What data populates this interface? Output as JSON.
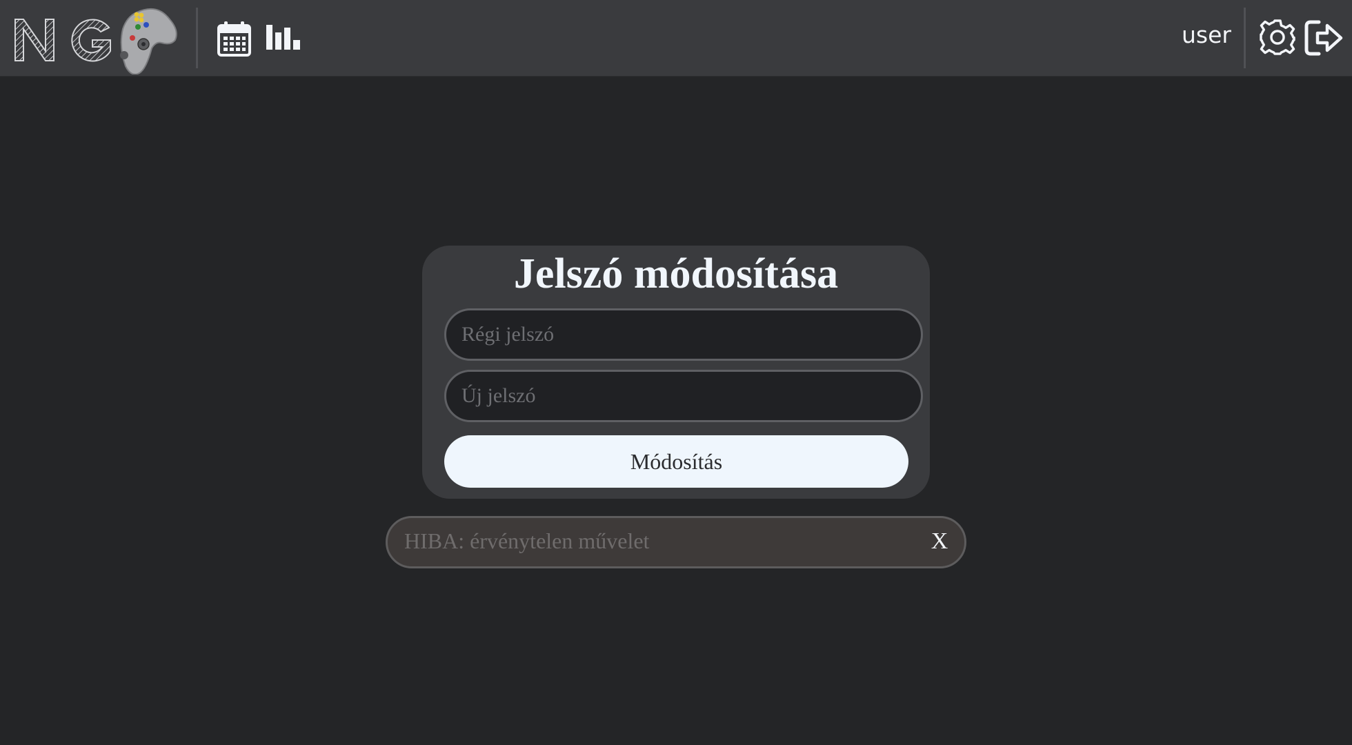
{
  "header": {
    "logo_text": "NG",
    "username": "user",
    "nav": {
      "calendar_icon": "calendar-icon",
      "stats_icon": "bar-chart-icon"
    },
    "actions": {
      "settings_icon": "gear-icon",
      "logout_icon": "logout-icon"
    }
  },
  "form": {
    "title": "Jelszó módosítása",
    "old_password": {
      "value": "",
      "placeholder": "Régi jelszó"
    },
    "new_password": {
      "value": "",
      "placeholder": "Új jelszó"
    },
    "submit_label": "Módosítás"
  },
  "error": {
    "message": "HIBA: érvénytelen művelet",
    "close_label": "X"
  },
  "colors": {
    "background": "#242527",
    "topbar": "#3a3b3e",
    "card": "#3a3b3e",
    "button": "#eff6fd",
    "error_bg": "#3e3a39"
  }
}
